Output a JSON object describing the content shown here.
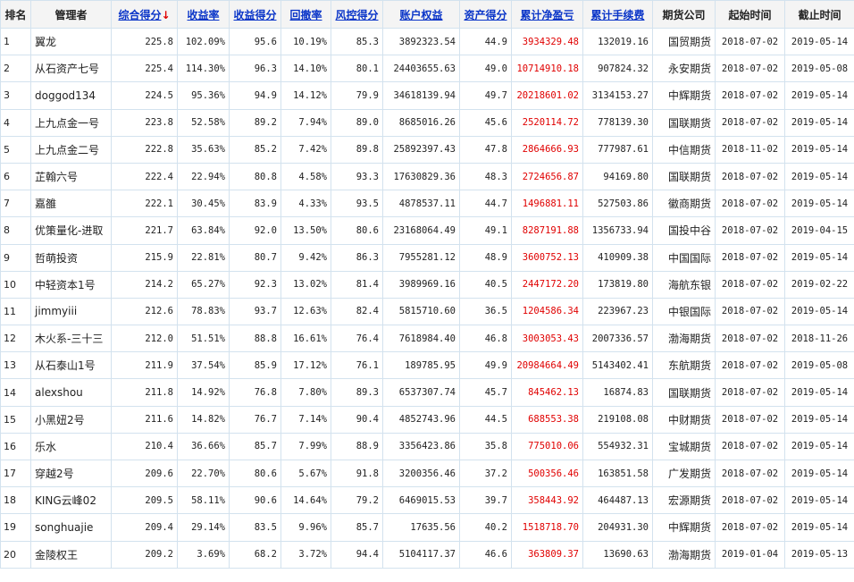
{
  "headers": [
    {
      "label": "排名",
      "sortable": false
    },
    {
      "label": "管理者",
      "sortable": false
    },
    {
      "label": "综合得分",
      "sortable": true,
      "arrow": "↓"
    },
    {
      "label": "收益率",
      "sortable": true
    },
    {
      "label": "收益得分",
      "sortable": true
    },
    {
      "label": "回撤率",
      "sortable": true
    },
    {
      "label": "风控得分",
      "sortable": true
    },
    {
      "label": "账户权益",
      "sortable": true
    },
    {
      "label": "资产得分",
      "sortable": true
    },
    {
      "label": "累计净盈亏",
      "sortable": true
    },
    {
      "label": "累计手续费",
      "sortable": true
    },
    {
      "label": "期货公司",
      "sortable": false
    },
    {
      "label": "起始时间",
      "sortable": false
    },
    {
      "label": "截止时间",
      "sortable": false
    }
  ],
  "colors": {
    "link": "#0a35c8",
    "profit": "#e00000",
    "grid": "#d3e2ee"
  },
  "rows": [
    [
      "1",
      "翼龙",
      "225.8",
      "102.09%",
      "95.6",
      "10.19%",
      "85.3",
      "3892323.54",
      "44.9",
      "3934329.48",
      "132019.16",
      "国贸期货",
      "2018-07-02",
      "2019-05-14"
    ],
    [
      "2",
      "从石资产七号",
      "225.4",
      "114.30%",
      "96.3",
      "14.10%",
      "80.1",
      "24403655.63",
      "49.0",
      "10714910.18",
      "907824.32",
      "永安期货",
      "2018-07-02",
      "2019-05-08"
    ],
    [
      "3",
      "doggod134",
      "224.5",
      "95.36%",
      "94.9",
      "14.12%",
      "79.9",
      "34618139.94",
      "49.7",
      "20218601.02",
      "3134153.27",
      "中辉期货",
      "2018-07-02",
      "2019-05-14"
    ],
    [
      "4",
      "上九点金一号",
      "223.8",
      "52.58%",
      "89.2",
      "7.94%",
      "89.0",
      "8685016.26",
      "45.6",
      "2520114.72",
      "778139.30",
      "国联期货",
      "2018-07-02",
      "2019-05-14"
    ],
    [
      "5",
      "上九点金二号",
      "222.8",
      "35.63%",
      "85.2",
      "7.42%",
      "89.8",
      "25892397.43",
      "47.8",
      "2864666.93",
      "777987.61",
      "中信期货",
      "2018-11-02",
      "2019-05-14"
    ],
    [
      "6",
      "芷翰六号",
      "222.4",
      "22.94%",
      "80.8",
      "4.58%",
      "93.3",
      "17630829.36",
      "48.3",
      "2724656.87",
      "94169.80",
      "国联期货",
      "2018-07-02",
      "2019-05-14"
    ],
    [
      "7",
      "嘉雒",
      "222.1",
      "30.45%",
      "83.9",
      "4.33%",
      "93.5",
      "4878537.11",
      "44.7",
      "1496881.11",
      "527503.86",
      "徽商期货",
      "2018-07-02",
      "2019-05-14"
    ],
    [
      "8",
      "优策量化-进取",
      "221.7",
      "63.84%",
      "92.0",
      "13.50%",
      "80.6",
      "23168064.49",
      "49.1",
      "8287191.88",
      "1356733.94",
      "国投中谷",
      "2018-07-02",
      "2019-04-15"
    ],
    [
      "9",
      "哲萌投资",
      "215.9",
      "22.81%",
      "80.7",
      "9.42%",
      "86.3",
      "7955281.12",
      "48.9",
      "3600752.13",
      "410909.38",
      "中国国际",
      "2018-07-02",
      "2019-05-14"
    ],
    [
      "10",
      "中轻资本1号",
      "214.2",
      "65.27%",
      "92.3",
      "13.02%",
      "81.4",
      "3989969.16",
      "40.5",
      "2447172.20",
      "173819.80",
      "海航东银",
      "2018-07-02",
      "2019-02-22"
    ],
    [
      "11",
      "jimmyiii",
      "212.6",
      "78.83%",
      "93.7",
      "12.63%",
      "82.4",
      "5815710.60",
      "36.5",
      "1204586.34",
      "223967.23",
      "中银国际",
      "2018-07-02",
      "2019-05-14"
    ],
    [
      "12",
      "木火系-三十三",
      "212.0",
      "51.51%",
      "88.8",
      "16.61%",
      "76.4",
      "7618984.40",
      "46.8",
      "3003053.43",
      "2007336.57",
      "渤海期货",
      "2018-07-02",
      "2018-11-26"
    ],
    [
      "13",
      "从石泰山1号",
      "211.9",
      "37.54%",
      "85.9",
      "17.12%",
      "76.1",
      "189785.95",
      "49.9",
      "20984664.49",
      "5143402.41",
      "东航期货",
      "2018-07-02",
      "2019-05-08"
    ],
    [
      "14",
      "alexshou",
      "211.8",
      "14.92%",
      "76.8",
      "7.80%",
      "89.3",
      "6537307.74",
      "45.7",
      "845462.13",
      "16874.83",
      "国联期货",
      "2018-07-02",
      "2019-05-14"
    ],
    [
      "15",
      "小黑妞2号",
      "211.6",
      "14.82%",
      "76.7",
      "7.14%",
      "90.4",
      "4852743.96",
      "44.5",
      "688553.38",
      "219108.08",
      "中财期货",
      "2018-07-02",
      "2019-05-14"
    ],
    [
      "16",
      "乐水",
      "210.4",
      "36.66%",
      "85.7",
      "7.99%",
      "88.9",
      "3356423.86",
      "35.8",
      "775010.06",
      "554932.31",
      "宝城期货",
      "2018-07-02",
      "2019-05-14"
    ],
    [
      "17",
      "穿越2号",
      "209.6",
      "22.70%",
      "80.6",
      "5.67%",
      "91.8",
      "3200356.46",
      "37.2",
      "500356.46",
      "163851.58",
      "广发期货",
      "2018-07-02",
      "2019-05-14"
    ],
    [
      "18",
      "KING云峰02",
      "209.5",
      "58.11%",
      "90.6",
      "14.64%",
      "79.2",
      "6469015.53",
      "39.7",
      "358443.92",
      "464487.13",
      "宏源期货",
      "2018-07-02",
      "2019-05-14"
    ],
    [
      "19",
      "songhuajie",
      "209.4",
      "29.14%",
      "83.5",
      "9.96%",
      "85.7",
      "17635.56",
      "40.2",
      "1518718.70",
      "204931.30",
      "中辉期货",
      "2018-07-02",
      "2019-05-14"
    ],
    [
      "20",
      "金陵权王",
      "209.2",
      "3.69%",
      "68.2",
      "3.72%",
      "94.4",
      "5104117.37",
      "46.6",
      "363809.37",
      "13690.63",
      "渤海期货",
      "2019-01-04",
      "2019-05-13"
    ]
  ]
}
